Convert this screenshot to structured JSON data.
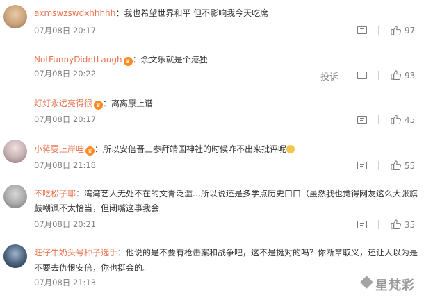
{
  "comments": [
    {
      "username": "axmswzswdxhhhhh",
      "text": "：我也希望世界和平 但不影响我今天吃席",
      "time": "07月08日 20:17",
      "likes": "97",
      "avatar_color": "#c9a27a"
    },
    {
      "username": "NotFunnyDidntLaugh",
      "text": "：余文乐就是个港独",
      "time": "07月08日 20:22",
      "likes": "93",
      "report": "投诉"
    },
    {
      "username": "灯灯永远亮得很",
      "text": "：离离原上谱",
      "time": "07月08日 20:17",
      "likes": "45"
    },
    {
      "username": "小蒋要上岸哇",
      "text": "：所以安倍晋三参拜靖国神社的时候咋不出来批评呢",
      "time": "07月08日 21:18",
      "likes": "55",
      "avatar_color": "#b8a8a8"
    },
    {
      "username": "不吃松子耶",
      "line1": "：湾湾艺人无处不在的文青泛滥…所以说还是多学点历史口口（虽然我也觉得网友这么大张旗",
      "line2": "鼓嘲讽不太恰当，但闭嘴这事我会",
      "time": "07月08日 20:21",
      "likes": "35",
      "avatar_color": "#9a9a9a"
    },
    {
      "username": "旺仔牛奶头号种子选手",
      "line1": "：他说的是不要有枪击案和战争吧，这不是挺对的吗？你断章取义，还让人以为是",
      "line2": "不要去仇恨安倍，你也挺会的。",
      "time": "07月08日 21:13",
      "avatar_color": "#4a5f7a"
    }
  ],
  "watermark": "星梵彩",
  "colors": {
    "username": "#eb7350",
    "text": "#333333",
    "meta": "#808080",
    "badge": "#ff8a1f"
  }
}
